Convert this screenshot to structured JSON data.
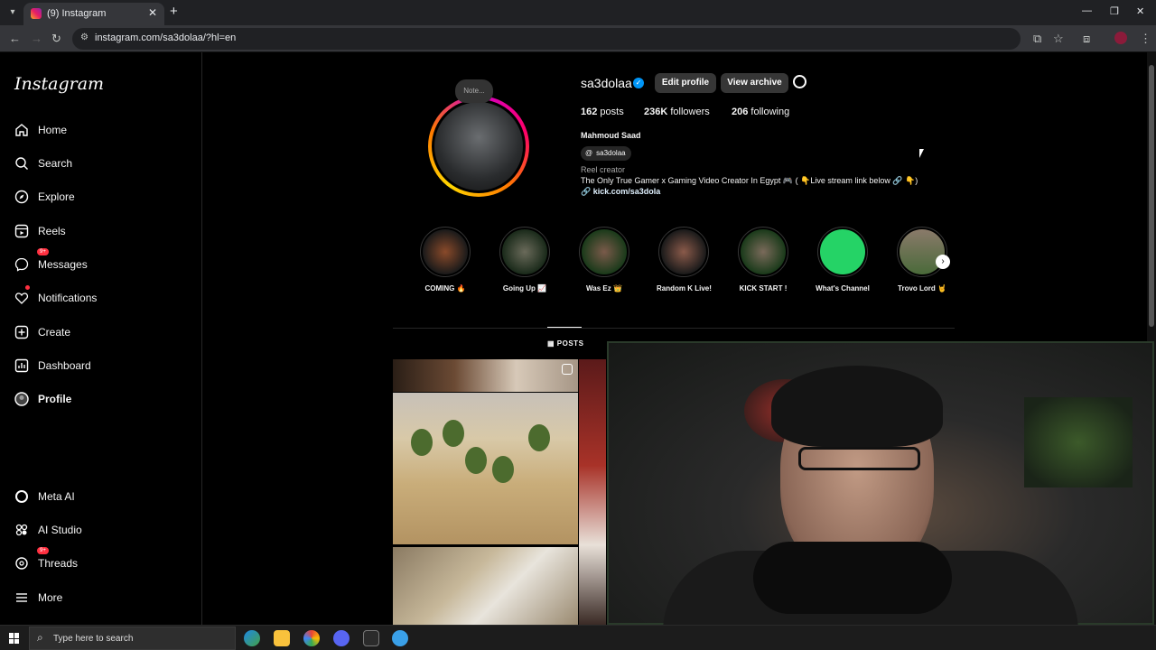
{
  "browser": {
    "tab_title": "(9) Instagram",
    "url": "instagram.com/sa3dolaa/?hl=en"
  },
  "sidebar": {
    "logo": "Instagram",
    "items": [
      {
        "label": "Home",
        "icon": "home-icon"
      },
      {
        "label": "Search",
        "icon": "search-icon"
      },
      {
        "label": "Explore",
        "icon": "compass-icon"
      },
      {
        "label": "Reels",
        "icon": "reels-icon"
      },
      {
        "label": "Messages",
        "icon": "messenger-icon",
        "badge": "9+"
      },
      {
        "label": "Notifications",
        "icon": "heart-icon"
      },
      {
        "label": "Create",
        "icon": "plus-square-icon"
      },
      {
        "label": "Dashboard",
        "icon": "chart-icon"
      },
      {
        "label": "Profile",
        "icon": "avatar-icon"
      }
    ],
    "bottom_items": [
      {
        "label": "Meta AI",
        "icon": "meta-ai-icon"
      },
      {
        "label": "AI Studio",
        "icon": "ai-studio-icon"
      },
      {
        "label": "Threads",
        "icon": "threads-icon",
        "badge": "9+"
      },
      {
        "label": "More",
        "icon": "menu-icon"
      }
    ]
  },
  "profile": {
    "note": "Note...",
    "username": "sa3dolaa",
    "edit_profile": "Edit profile",
    "view_archive": "View archive",
    "posts_count": "162",
    "posts_label": "posts",
    "followers_count": "236K",
    "followers_label": "followers",
    "following_count": "206",
    "following_label": "following",
    "full_name": "Mahmoud Saad",
    "threads_handle": "sa3dolaa",
    "category": "Reel creator",
    "bio": "The Only True Gamer x Gaming Video Creator In Egypt 🎮 ( 👇Live stream link below 🔗 👇)",
    "link": "kick.com/sa3dola"
  },
  "highlights": [
    {
      "label": "COMING 🔥"
    },
    {
      "label": "Going Up 📈"
    },
    {
      "label": "Was Ez 👑"
    },
    {
      "label": "Random K Live!"
    },
    {
      "label": "KICK START !"
    },
    {
      "label": "What's Channel"
    },
    {
      "label": "Trovo Lord 🤘"
    }
  ],
  "tabs": {
    "posts": "POSTS"
  },
  "taskbar": {
    "search_placeholder": "Type here to search"
  },
  "colors": {
    "verified": "#0095f6",
    "badge": "#ff3040",
    "whatsapp": "#25d366"
  }
}
